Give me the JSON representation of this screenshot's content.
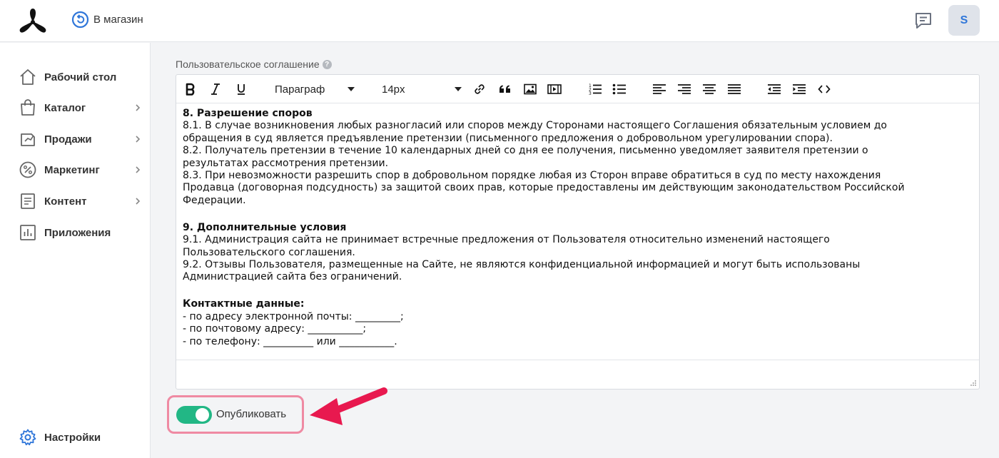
{
  "header": {
    "back_label": "В магазин",
    "avatar_letter": "S",
    "accent_color": "#2f76d9"
  },
  "sidebar": {
    "items": [
      {
        "label": "Рабочий стол",
        "icon": "home-icon",
        "has_chevron": false
      },
      {
        "label": "Каталог",
        "icon": "shopping-bag-icon",
        "has_chevron": true
      },
      {
        "label": "Продажи",
        "icon": "sales-icon",
        "has_chevron": true
      },
      {
        "label": "Маркетинг",
        "icon": "percent-icon",
        "has_chevron": true
      },
      {
        "label": "Контент",
        "icon": "document-icon",
        "has_chevron": true
      },
      {
        "label": "Приложения",
        "icon": "bar-chart-icon",
        "has_chevron": false
      }
    ],
    "settings_label": "Настройки"
  },
  "editor": {
    "field_label": "Пользовательское соглашение",
    "paragraph_select": "Параграф",
    "size_select": "14px",
    "toolbar_buttons": [
      "bold",
      "italic",
      "underline",
      "link",
      "quote",
      "image",
      "video",
      "ordered-list",
      "unordered-list",
      "align-left",
      "align-right",
      "align-center",
      "align-justify",
      "outdent",
      "indent",
      "code"
    ],
    "content": {
      "s8_title": "8. Разрешение споров",
      "s8_lines": [
        "8.1. В случае возникновения любых разногласий или споров между Сторонами настоящего Соглашения обязательным условием до",
        "обращения в суд является предъявление претензии (письменного предложения о добровольном урегулировании спора).",
        "8.2. Получатель претензии в течение 10 календарных дней со дня ее получения, письменно уведомляет заявителя претензии о",
        "результатах рассмотрения претензии.",
        "8.3. При невозможности разрешить спор в добровольном порядке любая из Сторон вправе обратиться в суд по месту нахождения",
        "Продавца (договорная подсудность) за защитой своих прав, которые предоставлены им действующим законодательством Российской",
        "Федерации."
      ],
      "s9_title": "9. Дополнительные условия",
      "s9_lines": [
        "9.1. Администрация сайта не принимает встречные предложения от Пользователя относительно изменений настоящего",
        "Пользовательского соглашения.",
        "9.2. Отзывы Пользователя, размещенные на Сайте, не являются конфиденциальной информацией и могут быть использованы",
        "Администрацией сайта без ограничений."
      ],
      "contacts_title": "Контактные данные:",
      "contacts_lines": [
        "- по адресу электронной почты: _________;",
        "- по почтовому адресу: ___________;",
        "- по телефону: __________ или ___________."
      ]
    }
  },
  "publish": {
    "label": "Опубликовать",
    "enabled": true,
    "toggle_color": "#22b785",
    "highlight_color": "#ef8aa3",
    "arrow_color": "#e8194f"
  }
}
